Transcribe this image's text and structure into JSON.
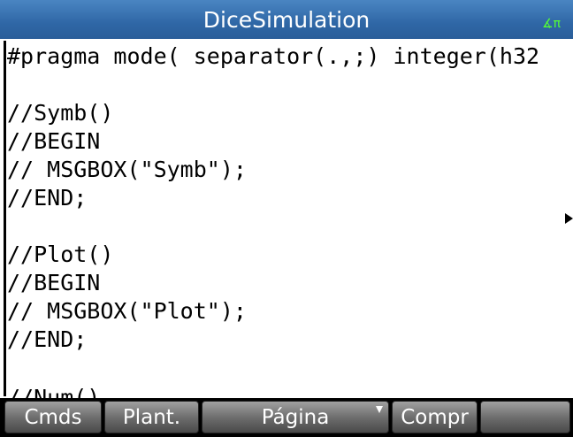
{
  "app": {
    "title": "DiceSimulation",
    "angle_indicator": "∡π"
  },
  "editor": {
    "lines": [
      "#pragma mode( separator(.,;) integer(h32",
      "",
      "//Symb()",
      "//BEGIN",
      "// MSGBOX(\"Symb\");",
      "//END;",
      "",
      "//Plot()",
      "//BEGIN",
      "// MSGBOX(\"Plot\");",
      "//END;",
      "",
      "//Num()"
    ]
  },
  "menu": {
    "cmds": "Cmds",
    "templates": "Plant.",
    "page": "Página",
    "check": "Compr",
    "blank": ""
  },
  "colors": {
    "title_bar": "#2f67a6",
    "title_text": "#ffffff",
    "angle_indicator": "#55ff33",
    "menu_bar": "#000000",
    "softkey": "#6a6a6a"
  }
}
